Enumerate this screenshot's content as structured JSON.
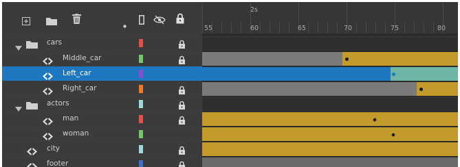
{
  "toolbar": {
    "icons": [
      "new-layer-icon",
      "new-folder-icon",
      "trash-icon",
      "dot-icon",
      "outline-icon",
      "visibility-icon",
      "lock-icon"
    ]
  },
  "ruler": {
    "seconds_label": "2s",
    "frames": [
      "55",
      "60",
      "65",
      "70",
      "75",
      "80"
    ]
  },
  "layers": [
    {
      "name": "cars",
      "type": "folder",
      "expanded": true,
      "color": "#e0504c",
      "locked": true
    },
    {
      "name": "Middle_car",
      "type": "layer",
      "color": "#77c56e",
      "locked": true
    },
    {
      "name": "Left_car",
      "type": "layer",
      "color": "#8a4fd0",
      "locked": false,
      "selected": true
    },
    {
      "name": "Right_car",
      "type": "layer",
      "color": "#f07a28",
      "locked": true
    },
    {
      "name": "actors",
      "type": "folder",
      "expanded": true,
      "color": "#9fd8d8",
      "locked": true
    },
    {
      "name": "man",
      "type": "layer",
      "color": "#e5504c",
      "locked": true
    },
    {
      "name": "woman",
      "type": "layer",
      "color": "#77c56e",
      "locked": false
    },
    {
      "name": "city",
      "type": "layer",
      "color": "#9fd8d8",
      "locked": true
    },
    {
      "name": "footer",
      "type": "layer",
      "color": "#3f6ec9",
      "locked": true
    }
  ],
  "colors": {
    "tween": "#c39a2c",
    "tween_selected": "#6fb5a6",
    "frames_gray": "#7a7a7a",
    "selected_blue": "#1d78c1",
    "playhead": "#b00000"
  }
}
